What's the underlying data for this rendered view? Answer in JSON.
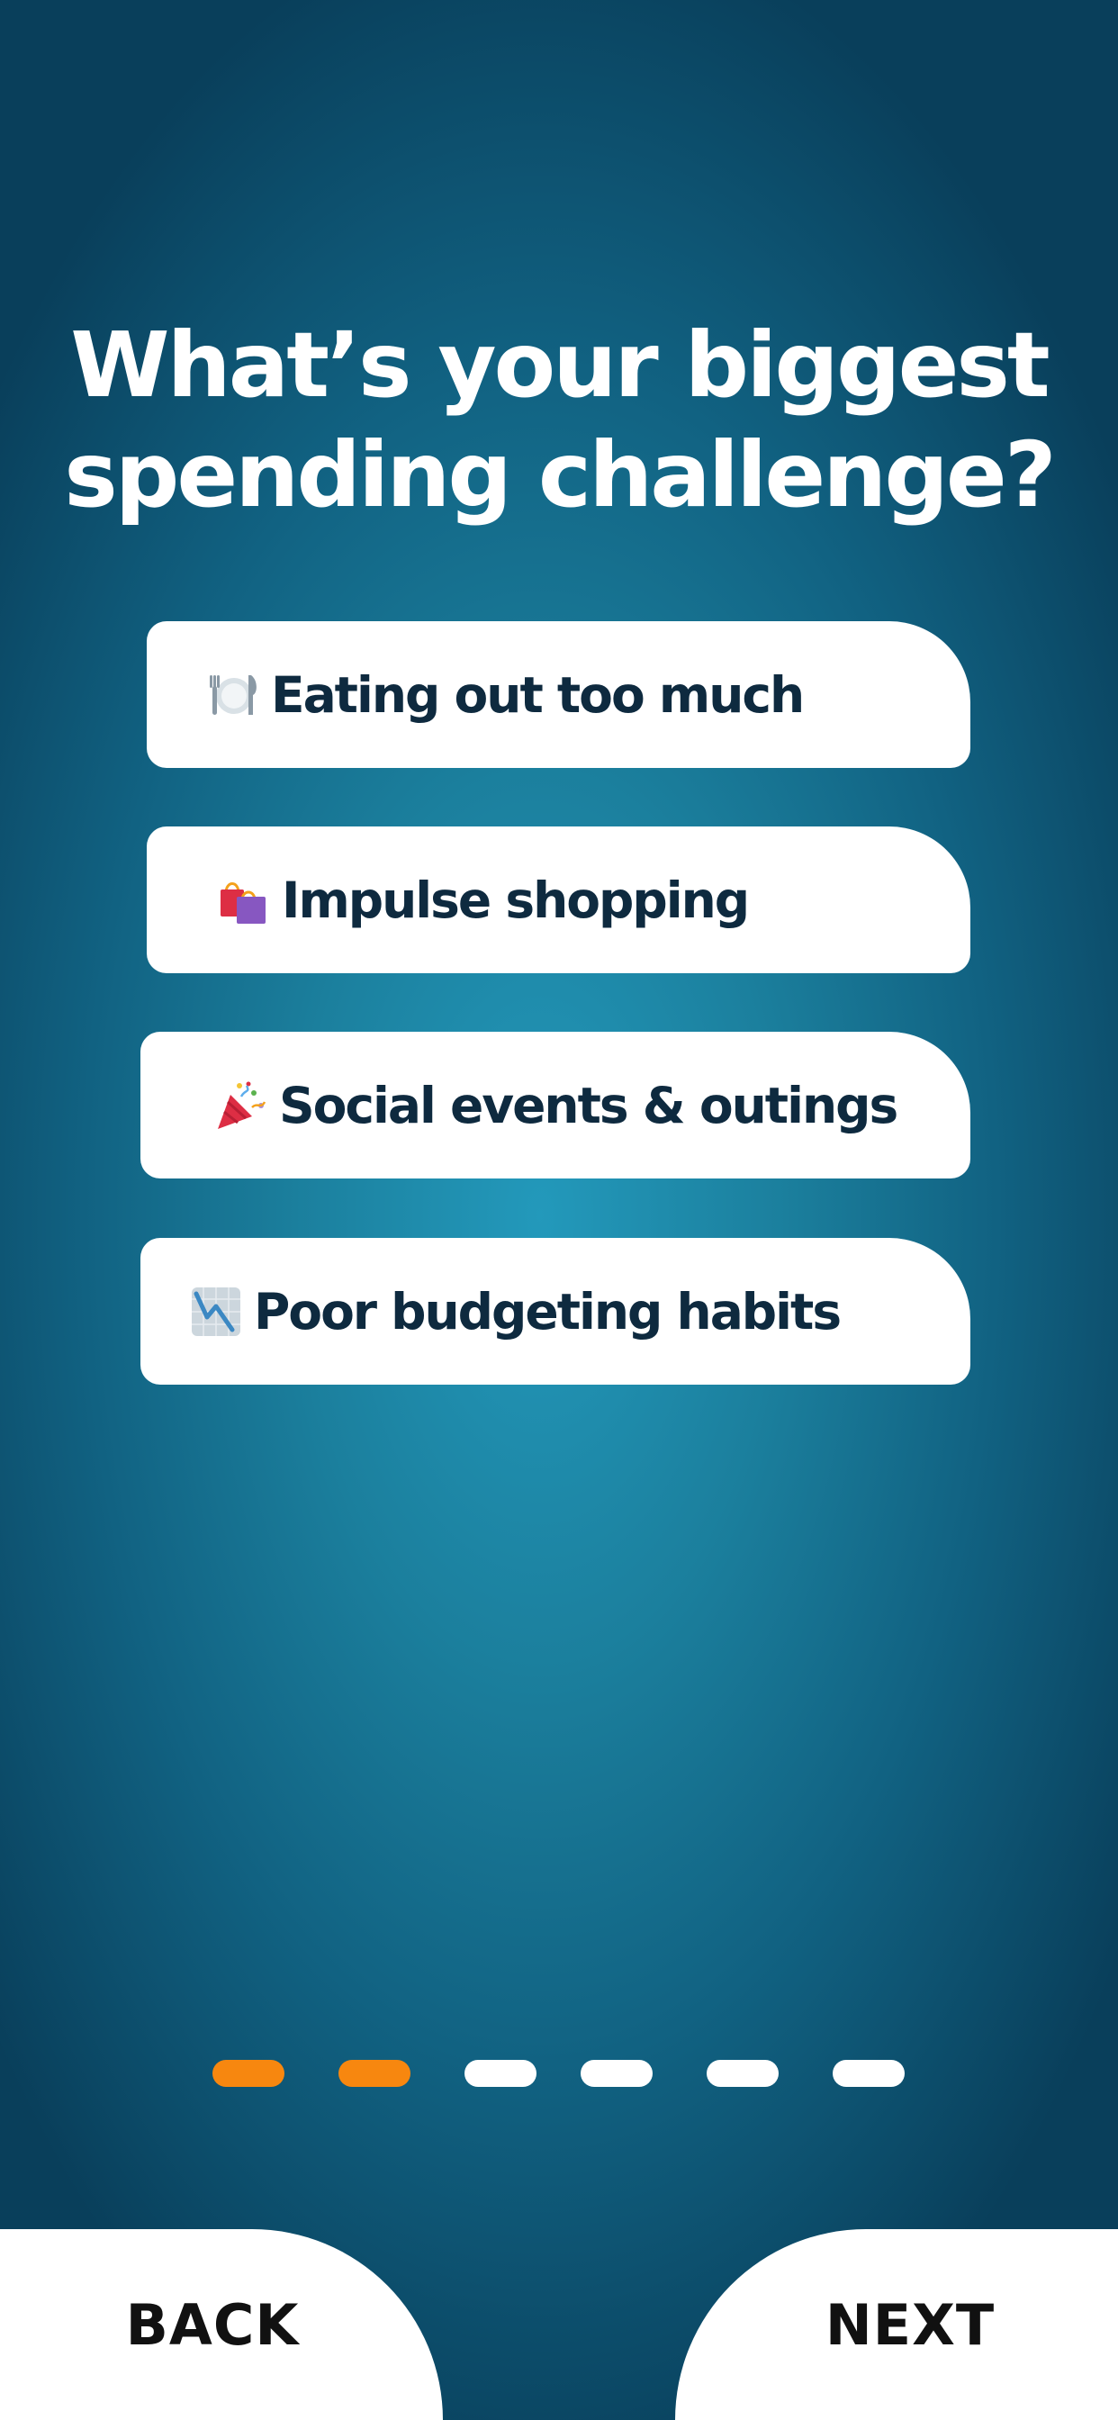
{
  "question": {
    "line1": "What’s your biggest",
    "line2": "spending challenge?"
  },
  "options": [
    {
      "icon": "fork-knife-plate-icon",
      "label": "Eating out too much"
    },
    {
      "icon": "shopping-bags-icon",
      "label": "Impulse shopping"
    },
    {
      "icon": "party-popper-icon",
      "label": "Social events & outings"
    },
    {
      "icon": "chart-decreasing-icon",
      "label": "Poor budgeting habits"
    }
  ],
  "progress": {
    "total_steps": 6,
    "completed_steps": 2,
    "active_color": "#f7870f",
    "inactive_color": "#ffffff"
  },
  "navigation": {
    "back_label": "BACK",
    "next_label": "NEXT"
  },
  "colors": {
    "background_center": "#2399bb",
    "background_edge": "#093f5b",
    "option_text": "#0e2a3f"
  }
}
